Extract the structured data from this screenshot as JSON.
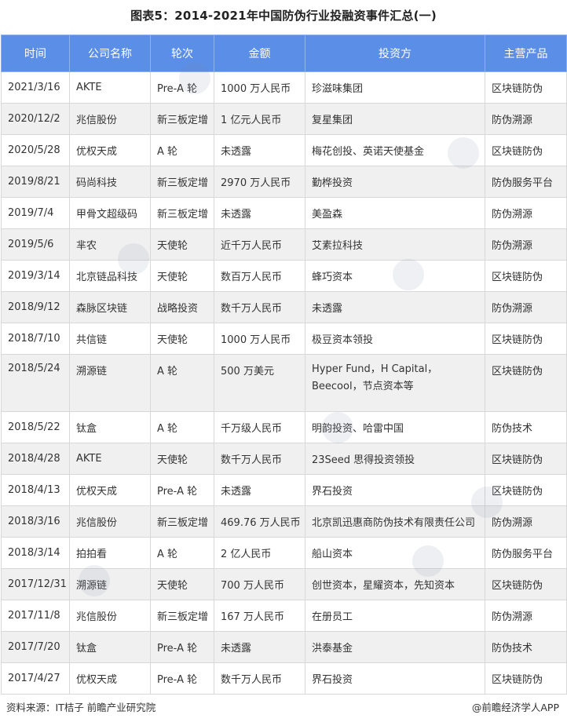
{
  "title": "图表5：2014-2021年中国防伪行业投融资事件汇总(一)",
  "headers": [
    "时间",
    "公司名称",
    "轮次",
    "金额",
    "投资方",
    "主营产品"
  ],
  "rows": [
    [
      "2021/3/16",
      "AKTE",
      "Pre-A 轮",
      "1000 万人民币",
      "珍滋味集团",
      "区块链防伪"
    ],
    [
      "2020/12/2",
      "兆信股份",
      "新三板定增",
      "1 亿元人民币",
      "复星集团",
      "防伪溯源"
    ],
    [
      "2020/5/28",
      "优权天成",
      "A 轮",
      "未透露",
      "梅花创投、英诺天使基金",
      "区块链防伪"
    ],
    [
      "2019/8/21",
      "码尚科技",
      "新三板定增",
      "2970 万人民币",
      "勤桦投资",
      "防伪服务平台"
    ],
    [
      "2019/7/4",
      "甲骨文超级码",
      "新三板定增",
      "未透露",
      "美盈森",
      "防伪溯源"
    ],
    [
      "2019/5/6",
      "芈农",
      "天使轮",
      "近千万人民币",
      "艾素拉科技",
      "防伪溯源"
    ],
    [
      "2019/3/14",
      "北京链品科技",
      "天使轮",
      "数百万人民币",
      "蜂巧资本",
      "区块链防伪"
    ],
    [
      "2018/9/12",
      "森脉区块链",
      "战略投资",
      "数千万人民币",
      "未透露",
      "防伪溯源"
    ],
    [
      "2018/7/10",
      "共信链",
      "天使轮",
      "1000 万人民币",
      "极豆资本领投",
      "区块链防伪"
    ],
    [
      "2018/5/24",
      "溯源链",
      "A 轮",
      "500 万美元",
      "Hyper Fund，H Capital，Beecool，节点资本等",
      "区块链防伪"
    ],
    [
      "2018/5/22",
      "钛盒",
      "A 轮",
      "千万级人民币",
      "明韵投资、哈雷中国",
      "防伪技术"
    ],
    [
      "2018/4/28",
      "AKTE",
      "天使轮",
      "数千万人民币",
      "23Seed 思得投资领投",
      "区块链防伪"
    ],
    [
      "2018/4/13",
      "优权天成",
      "Pre-A 轮",
      "未透露",
      "界石投资",
      "区块链防伪"
    ],
    [
      "2018/3/16",
      "兆信股份",
      "新三板定增",
      "469.76 万人民币",
      "北京凯迅惠商防伪技术有限责任公司",
      "防伪溯源"
    ],
    [
      "2018/3/14",
      "拍拍看",
      "A 轮",
      "2 亿人民币",
      "船山资本",
      "防伪服务平台"
    ],
    [
      "2017/12/31",
      "溯源链",
      "天使轮",
      "700 万人民币",
      "创世资本，星耀资本，先知资本",
      "区块链防伪"
    ],
    [
      "2017/11/8",
      "兆信股份",
      "新三板定增",
      "167 万人民币",
      "在册员工",
      "防伪溯源"
    ],
    [
      "2017/7/20",
      "钛盒",
      "Pre-A 轮",
      "未透露",
      "洪泰基金",
      "防伪技术"
    ],
    [
      "2017/4/27",
      "优权天成",
      "Pre-A 轮",
      "数千万人民币",
      "界石投资",
      "区块链防伪"
    ]
  ],
  "footer": {
    "source": "资料来源：IT桔子 前瞻产业研究院",
    "brand": "@前瞻经济学人APP"
  },
  "colors": {
    "header_bg": "#5b8ee6",
    "alt_row_bg": "#f0f0f0"
  }
}
